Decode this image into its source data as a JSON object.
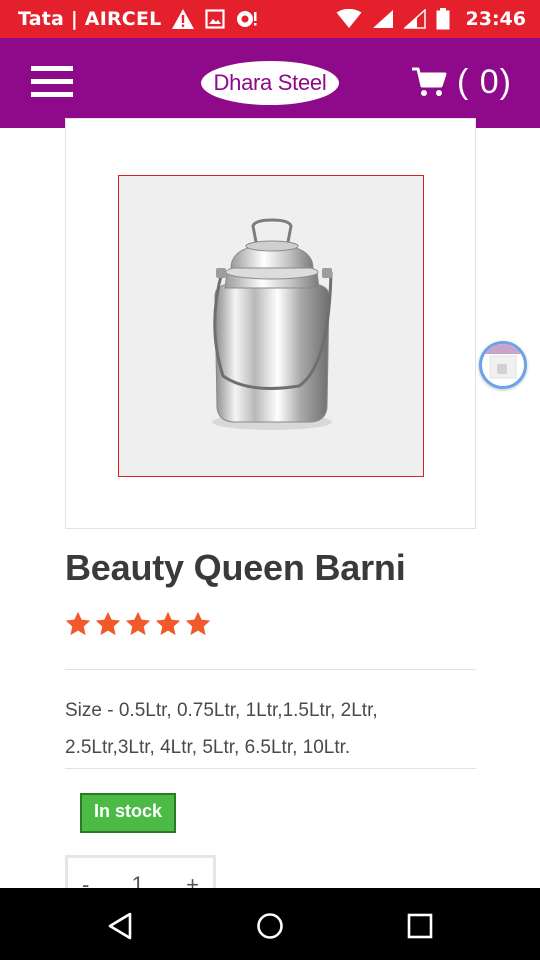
{
  "status_bar": {
    "carrier": "Tata | AIRCEL",
    "time": "23:46"
  },
  "app_bar": {
    "logo_text": "Dhara Steel",
    "cart_count": "( 0)"
  },
  "product": {
    "title": "Beauty Queen Barni",
    "rating": 5,
    "rating_max": 5,
    "description_line1": "Size - 0.5Ltr, 0.75Ltr, 1Ltr,1.5Ltr, 2Ltr,",
    "description_line2": "2.5Ltr,3Ltr, 4Ltr, 5Ltr, 6.5Ltr, 10Ltr.",
    "stock_status": "In stock",
    "quantity": "1",
    "qty_minus": "-",
    "qty_plus": "+"
  },
  "colors": {
    "status_bar": "#e3202b",
    "app_bar": "#8e0a8a",
    "star": "#f2592a",
    "in_stock": "#4cbb45"
  },
  "icons": {
    "menu": "hamburger-icon",
    "cart": "cart-icon",
    "back": "back-triangle-icon",
    "home": "home-circle-icon",
    "recents": "recents-square-icon"
  }
}
